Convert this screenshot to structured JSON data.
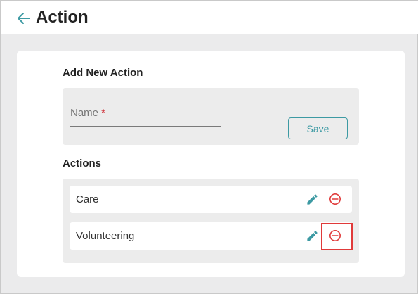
{
  "header": {
    "title": "Action",
    "back_icon": "arrow-left-icon"
  },
  "add_section": {
    "title": "Add New Action",
    "name_field": {
      "label": "Name",
      "required_marker": "*",
      "value": ""
    },
    "save_label": "Save"
  },
  "actions_section": {
    "title": "Actions",
    "items": [
      {
        "label": "Care",
        "edit_icon": "pencil-icon",
        "remove_icon": "minus-circle-icon"
      },
      {
        "label": "Volunteering",
        "edit_icon": "pencil-icon",
        "remove_icon": "minus-circle-icon"
      }
    ]
  },
  "colors": {
    "accent": "#3d9aa3",
    "danger": "#e03a3a",
    "background": "#ebebec"
  }
}
